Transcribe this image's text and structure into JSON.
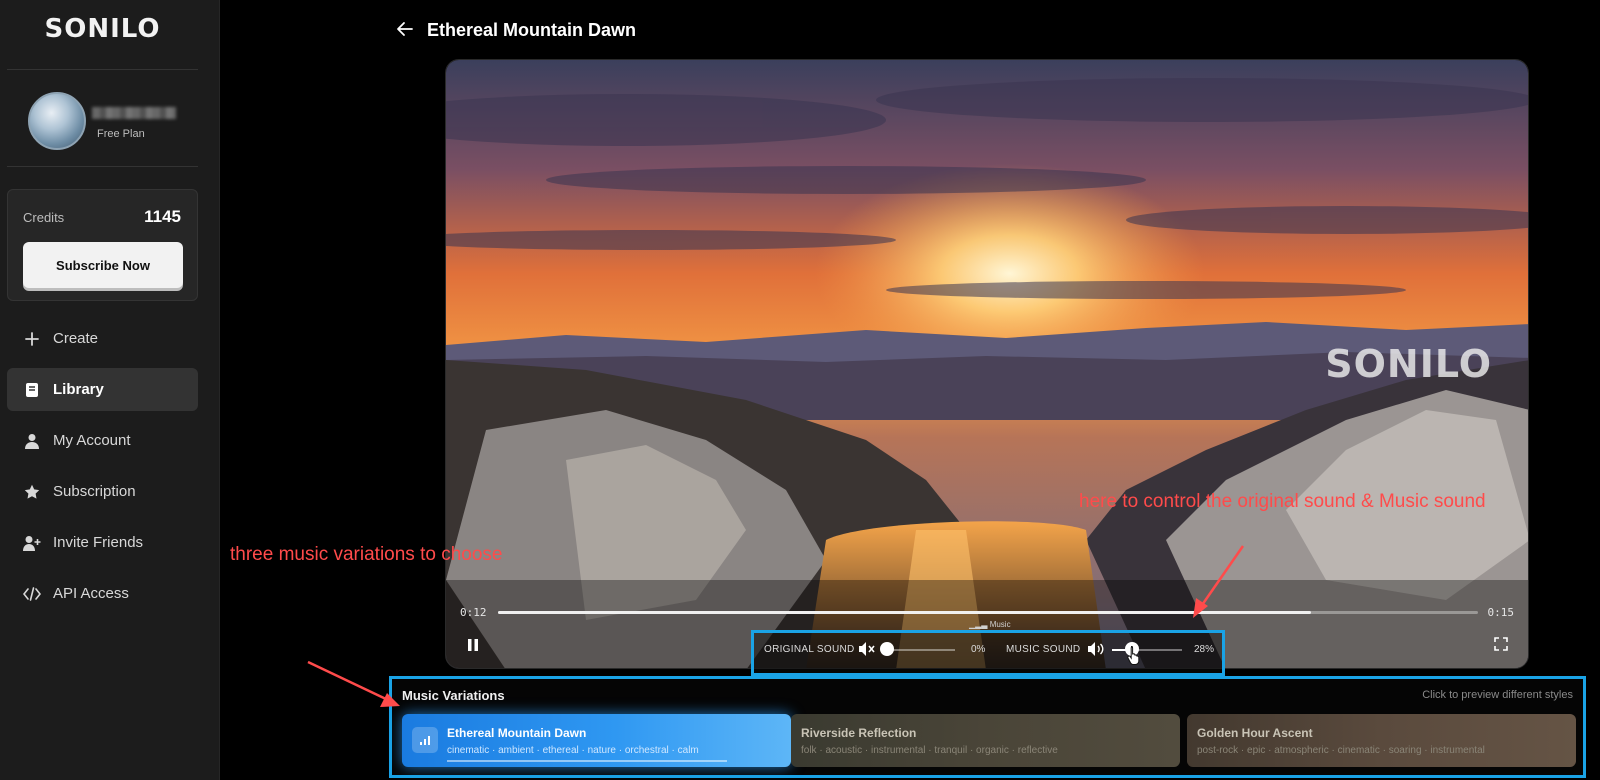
{
  "app": {
    "logo": "SONILO"
  },
  "user": {
    "plan": "Free Plan"
  },
  "credits": {
    "label": "Credits",
    "value": "1145",
    "subscribe_label": "Subscribe Now"
  },
  "nav": {
    "items": [
      {
        "label": "Create",
        "icon": "plus-icon"
      },
      {
        "label": "Library",
        "icon": "book-icon",
        "active": true
      },
      {
        "label": "My Account",
        "icon": "user-icon"
      },
      {
        "label": "Subscription",
        "icon": "star-icon"
      },
      {
        "label": "Invite Friends",
        "icon": "user-plus-icon"
      },
      {
        "label": "API Access",
        "icon": "code-icon"
      }
    ]
  },
  "header": {
    "title": "Ethereal Mountain Dawn"
  },
  "player": {
    "watermark": "SONILO",
    "current_time": "0:12",
    "total_time": "0:15",
    "progress": 0.83,
    "music_tag": "Music",
    "original_sound": {
      "label": "ORIGINAL SOUND",
      "value": "0%",
      "level": 0.0
    },
    "music_sound": {
      "label": "MUSIC SOUND",
      "value": "28%",
      "level": 0.28
    }
  },
  "variations": {
    "title": "Music Variations",
    "hint": "Click to preview different styles",
    "items": [
      {
        "name": "Ethereal Mountain Dawn",
        "tags": "cinematic · ambient · ethereal · nature · orchestral · calm",
        "active": true
      },
      {
        "name": "Riverside Reflection",
        "tags": "folk · acoustic · instrumental · tranquil · organic · reflective",
        "active": false
      },
      {
        "name": "Golden Hour Ascent",
        "tags": "post-rock · epic · atmospheric · cinematic · soaring · instrumental",
        "active": false
      }
    ]
  },
  "annotations": {
    "variations_note": "three music variations to choose",
    "sound_note": "here to control the original sound & Music sound"
  },
  "colors": {
    "highlight": "#1aa3e6",
    "annotation": "#ff4b4b",
    "active_variation": "#2f98f2"
  }
}
